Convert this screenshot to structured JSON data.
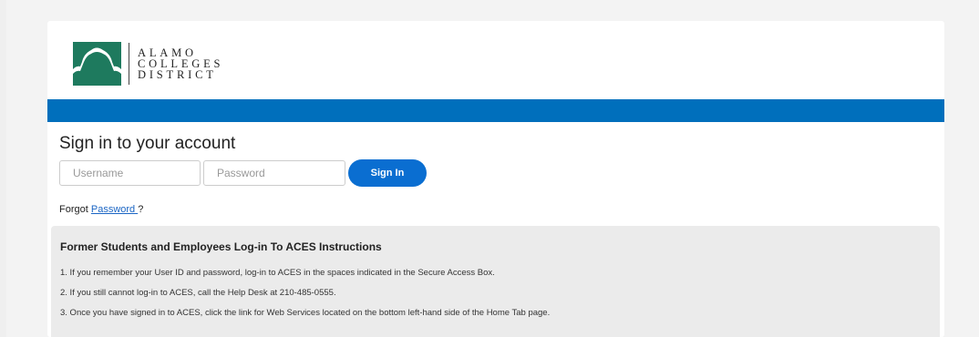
{
  "logo": {
    "lines": [
      "ALAMO",
      "COLLEGES",
      "DISTRICT"
    ],
    "mark_colors": {
      "green": "#1e7a5e",
      "white": "#ffffff"
    }
  },
  "header": {
    "bar_color": "#006fbc"
  },
  "signin": {
    "title": "Sign in to your account",
    "username_placeholder": "Username",
    "password_placeholder": "Password",
    "button_label": "Sign In",
    "button_color": "#0a6ed1"
  },
  "forgot": {
    "prefix": "Forgot ",
    "link": "Password ",
    "suffix": "?"
  },
  "instructions": {
    "title": "Former Students and Employees Log-in To ACES Instructions",
    "items": [
      "1. If you remember your User ID and password, log-in to ACES in the spaces indicated in the Secure Access Box.",
      "2. If you still cannot log-in to ACES, call the Help Desk at 210-485-0555.",
      "3. Once you have signed in to ACES, click the link for Web Services located on the bottom left-hand side of the Home Tab page."
    ]
  }
}
